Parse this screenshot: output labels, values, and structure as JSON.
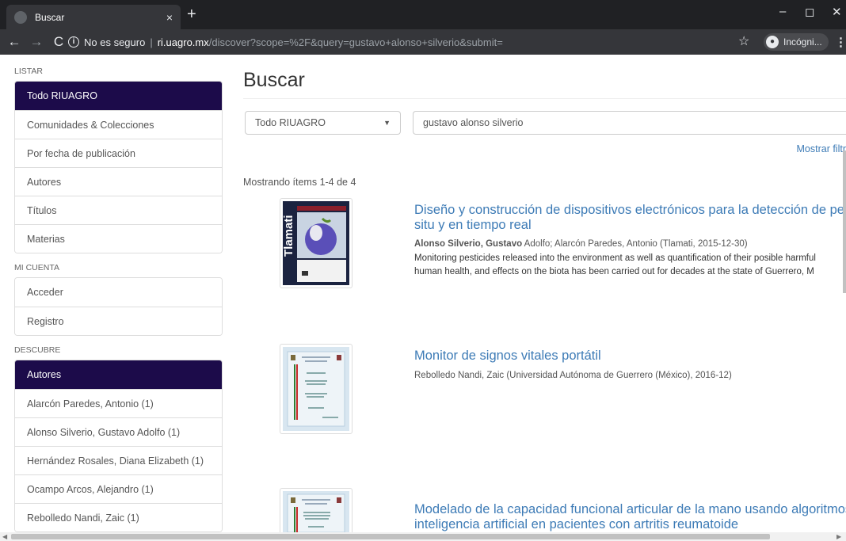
{
  "browser": {
    "tab_title": "Buscar",
    "tab_close": "×",
    "new_tab": "+",
    "win_min": "–",
    "win_max": "◻",
    "win_close": "✕",
    "back": "←",
    "forward": "→",
    "reload": "C",
    "info_glyph": "i",
    "not_secure": "No es seguro",
    "separator": "|",
    "host": "ri.uagro.mx",
    "path": "/discover?scope=%2F&query=gustavo+alonso+silverio&submit=",
    "star": "☆",
    "incognito_label": "Incógni...",
    "menu": "⋮"
  },
  "sidebar": {
    "listar_heading": "LISTAR",
    "listar_items": [
      {
        "label": "Todo RIUAGRO",
        "active": true
      },
      {
        "label": "Comunidades & Colecciones"
      },
      {
        "label": "Por fecha de publicación"
      },
      {
        "label": "Autores"
      },
      {
        "label": "Títulos"
      },
      {
        "label": "Materias"
      }
    ],
    "cuenta_heading": "MI CUENTA",
    "cuenta_items": [
      {
        "label": "Acceder"
      },
      {
        "label": "Registro"
      }
    ],
    "descubre_heading": "DESCUBRE",
    "descubre_items": [
      {
        "label": "Autores",
        "active": true
      },
      {
        "label": "Alarcón Paredes, Antonio (1)"
      },
      {
        "label": "Alonso Silverio, Gustavo Adolfo (1)"
      },
      {
        "label": "Hernández Rosales, Diana Elizabeth (1)"
      },
      {
        "label": "Ocampo Arcos, Alejandro (1)"
      },
      {
        "label": "Rebolledo Nandi, Zaic (1)"
      }
    ]
  },
  "main": {
    "title": "Buscar",
    "scope_value": "Todo RIUAGRO",
    "query_value": "gustavo alonso silverio",
    "filters_link": "Mostrar filtr",
    "result_count": "Mostrando ítems 1-4 de 4",
    "results": [
      {
        "title_line1": "Diseño y construcción de dispositivos electrónicos para la detección de pestic",
        "title_line2": "situ y en tiempo real",
        "author_bold": "Alonso Silverio, Gustavo",
        "meta_rest": " Adolfo; Alarcón Paredes, Antonio (Tlamati, 2015-12-30)",
        "abstract_line1": "Monitoring pesticides released into the environment as well as quantification of their posible harmful",
        "abstract_line2": "human health, and effects on the biota has been carried out for decades at the state of Guerrero, M",
        "cover_text": "Tlamati"
      },
      {
        "title_line1": "Monitor de signos vitales portátil",
        "meta": "Rebolledo Nandi, Zaic (Universidad Autónoma de Guerrero (México), 2016-12)"
      },
      {
        "title_line1": "Modelado de la capacidad funcional articular de la mano usando algoritmos d",
        "title_line2": "inteligencia artificial en pacientes con artritis reumatoide"
      }
    ]
  },
  "colors": {
    "active_bg": "#1c0b4a",
    "link": "#3d7bb6",
    "chrome_dark": "#202124",
    "chrome_toolbar": "#35363a"
  }
}
